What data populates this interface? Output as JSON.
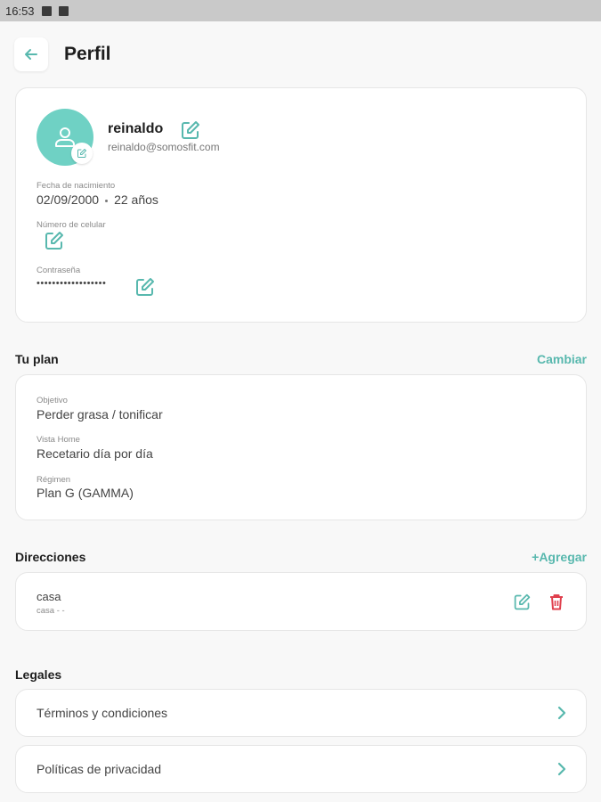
{
  "status_bar": {
    "time": "16:53"
  },
  "header": {
    "title": "Perfil"
  },
  "profile": {
    "name": "reinaldo",
    "email": "reinaldo@somosfit.com",
    "birth_label": "Fecha de nacimiento",
    "birth_date": "02/09/2000",
    "age": "22 años",
    "phone_label": "Número de celular",
    "password_label": "Contraseña",
    "password_value": "••••••••••••••••••"
  },
  "plan": {
    "section_title": "Tu plan",
    "action": "Cambiar",
    "objective_label": "Objetivo",
    "objective_value": "Perder grasa / tonificar",
    "home_label": "Vista Home",
    "home_value": "Recetario día por día",
    "regime_label": "Régimen",
    "regime_value": "Plan G (GAMMA)"
  },
  "addresses": {
    "section_title": "Direcciones",
    "action": "+Agregar",
    "items": [
      {
        "name": "casa",
        "detail": "casa - -"
      }
    ]
  },
  "legal": {
    "section_title": "Legales",
    "items": [
      {
        "label": "Términos y condiciones"
      },
      {
        "label": "Políticas de privacidad"
      }
    ]
  },
  "colors": {
    "accent": "#58b8ae",
    "avatar": "#6fd1c4",
    "delete": "#e0404e"
  },
  "icons": [
    "back-arrow-icon",
    "user-icon",
    "edit-icon",
    "trash-icon",
    "chevron-right-icon"
  ]
}
